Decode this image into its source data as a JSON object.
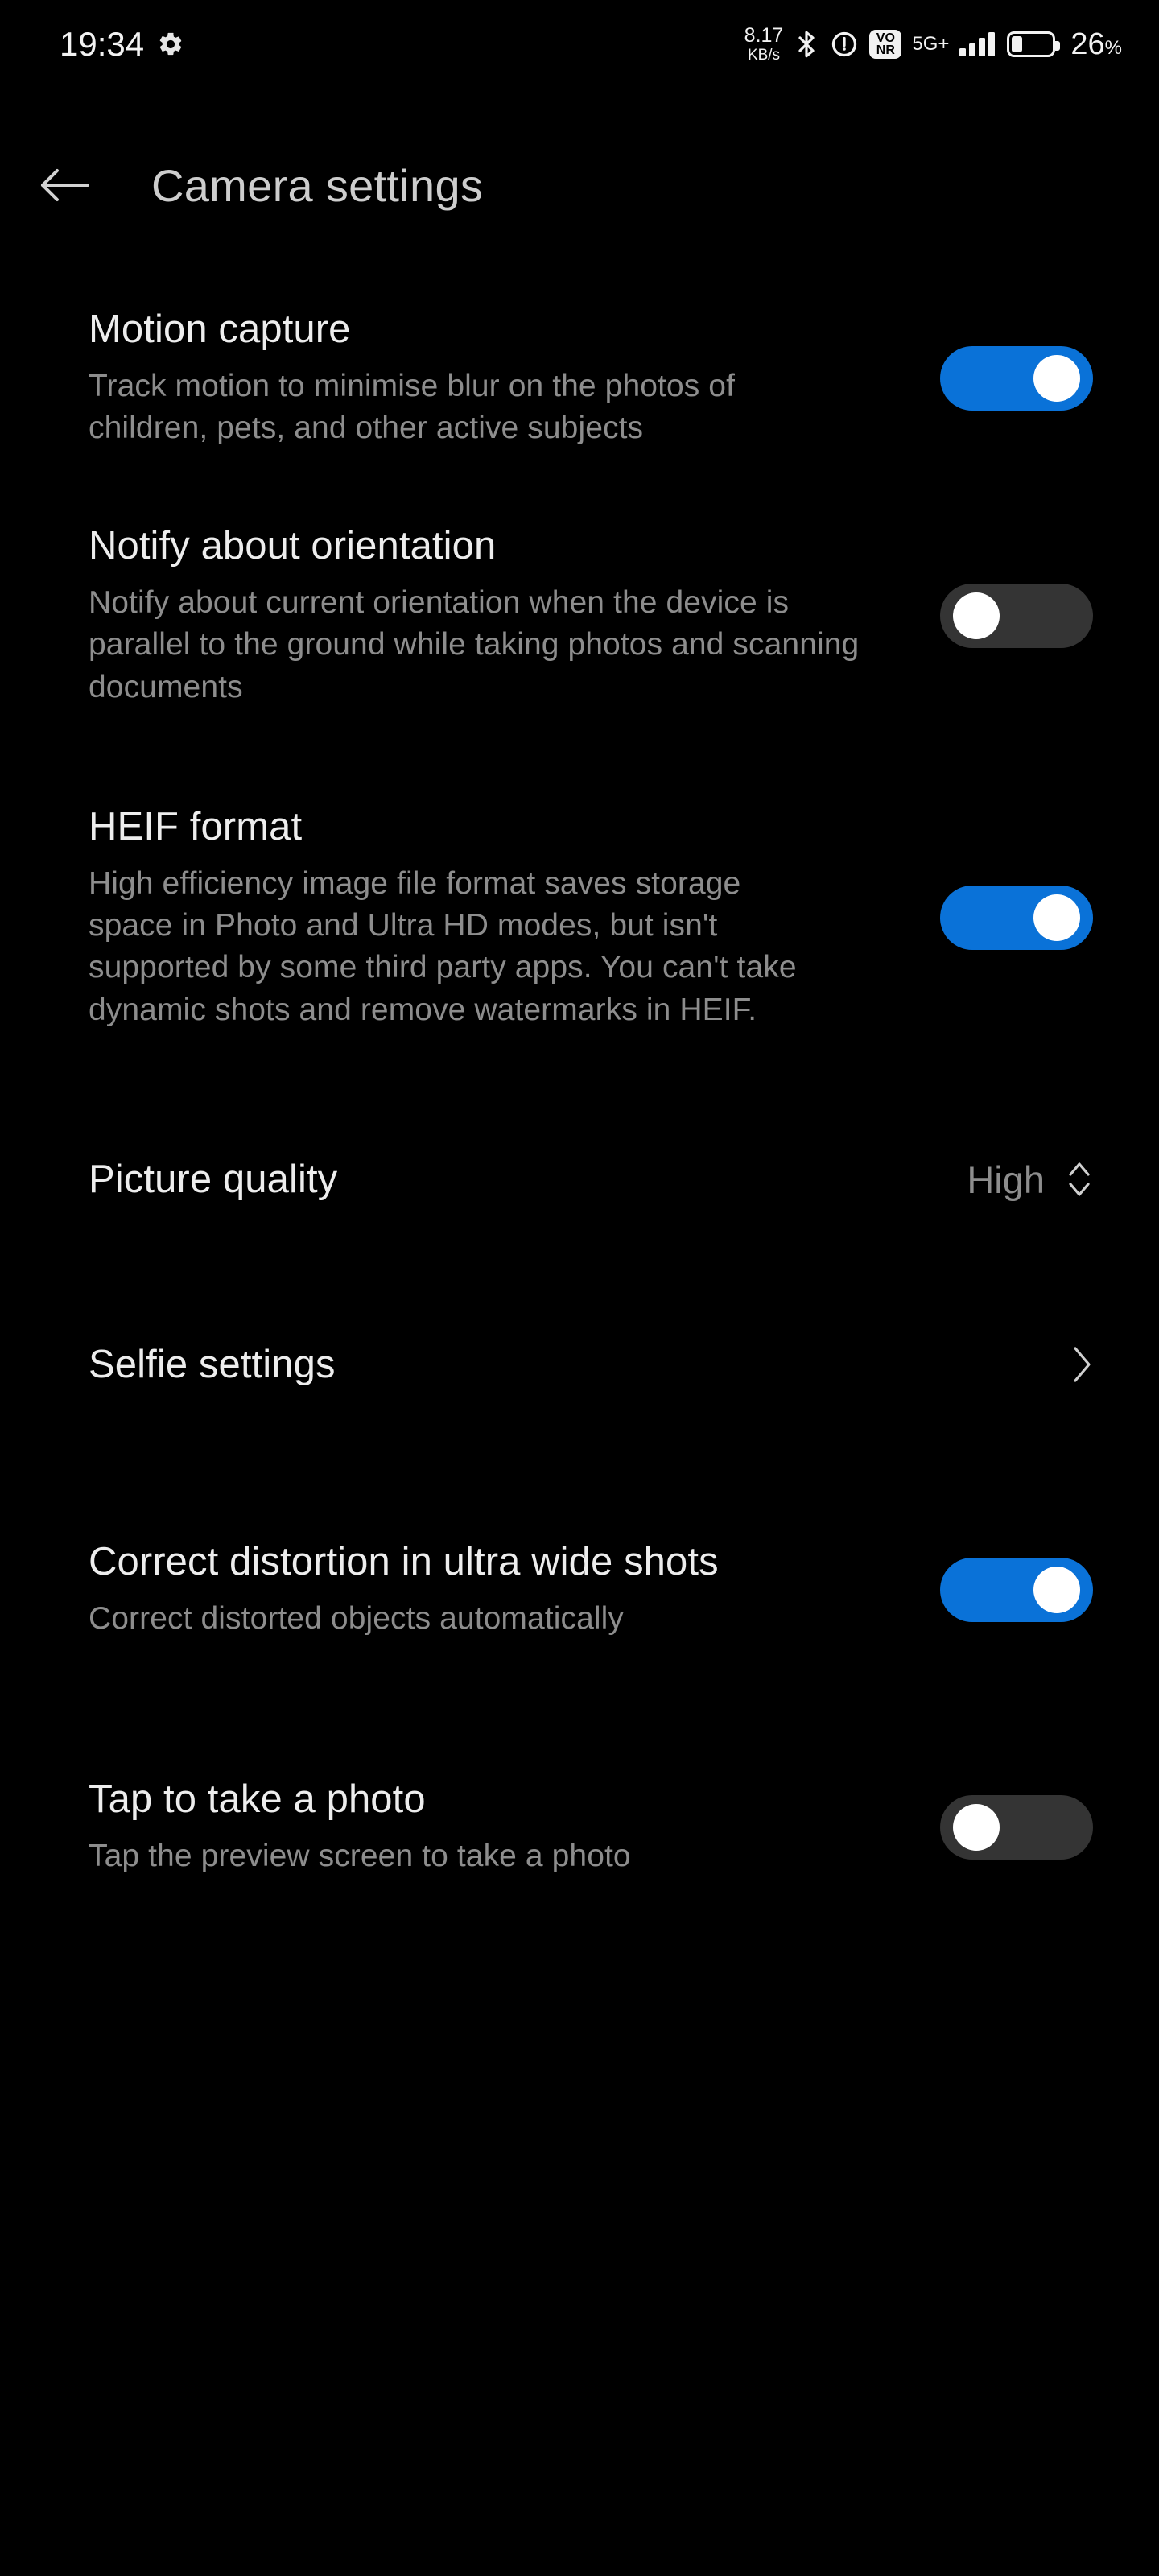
{
  "statusbar": {
    "clock": "19:34",
    "gear_icon": "gear-icon",
    "net_speed_value": "8.17",
    "net_speed_unit": "KB/s",
    "bluetooth_icon": "bluetooth-icon",
    "circle_icon": "data-saver-icon",
    "vonr_line1": "VO",
    "vonr_line2": "NR",
    "network_type": "5G+",
    "signal_icon": "signal-bars-icon",
    "battery_icon": "battery-icon",
    "battery_percent": "26",
    "battery_percent_symbol": "%"
  },
  "header": {
    "back_icon": "arrow-left-icon",
    "title": "Camera settings"
  },
  "colors": {
    "background": "#000000",
    "toggle_on": "#0a72d8",
    "toggle_off": "#343434",
    "knob": "#ffffff",
    "title_text": "#ededed",
    "desc_text": "#8d8d8d",
    "header_text": "#cdcdcd"
  },
  "settings": [
    {
      "id": "motion-capture",
      "title": "Motion capture",
      "desc": "Track motion to minimise blur on the photos of children, pets, and other active subjects",
      "control": "toggle",
      "value": "on"
    },
    {
      "id": "notify-about-orientation",
      "title": "Notify about orientation",
      "desc": "Notify about current orientation when the device is parallel to the ground while taking photos and scanning documents",
      "control": "toggle",
      "value": "off"
    },
    {
      "id": "heif-format",
      "title": "HEIF format",
      "desc": "High efficiency image file format saves storage space in Photo and Ultra HD modes, but isn't supported by some third party apps. You can't take dynamic shots and remove watermarks in HEIF.",
      "control": "toggle",
      "value": "on"
    },
    {
      "id": "picture-quality",
      "title": "Picture quality",
      "desc": "",
      "control": "value-stepper",
      "value": "High",
      "stepper_icon": "chevron-up-down-icon"
    },
    {
      "id": "selfie-settings",
      "title": "Selfie settings",
      "desc": "",
      "control": "navigation",
      "value": "",
      "chevron_icon": "chevron-right-icon"
    },
    {
      "id": "correct-distortion-ultra-wide",
      "title": "Correct distortion in ultra wide shots",
      "desc": "Correct distorted objects automatically",
      "control": "toggle",
      "value": "on"
    },
    {
      "id": "tap-to-take-a-photo",
      "title": "Tap to take a photo",
      "desc": "Tap the preview screen to take a photo",
      "control": "toggle",
      "value": "off"
    }
  ]
}
